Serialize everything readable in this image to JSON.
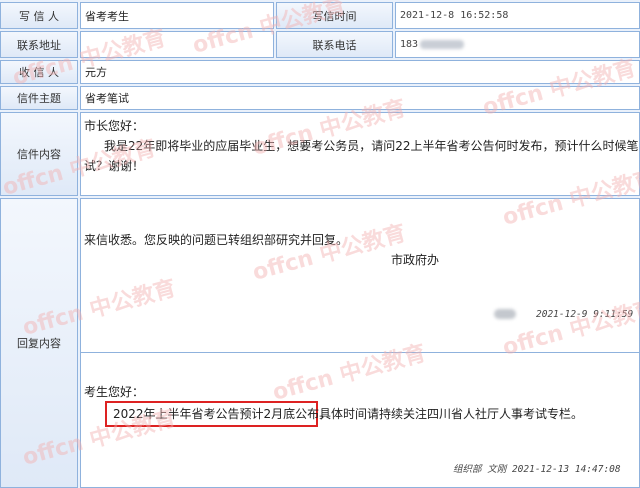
{
  "letter": {
    "writer_label": "写 信 人",
    "writer_value": "省考考生",
    "write_time_label": "写信时间",
    "write_time_value": "2021-12-8 16:52:58",
    "address_label": "联系地址",
    "phone_label": "联系电话",
    "phone_value": "183",
    "recipient_label": "收 信 人",
    "recipient_value": "元方",
    "subject_label": "信件主题",
    "subject_value": "省考笔试",
    "content_label": "信件内容",
    "content_greeting": "市长您好：",
    "content_line1": "我是22年即将毕业的应届毕业生，想要考公务员，请问22上半年省考公告何时发布，预计什么时候笔",
    "content_line2": "试？谢谢！"
  },
  "reply": {
    "label": "回复内容",
    "first": {
      "text": "来信收悉。您反映的问题已转组织部研究并回复。",
      "signature": "市政府办",
      "timestamp": "2021-12-9 9:11:59"
    },
    "second": {
      "greeting": "考生您好：",
      "highlight": "2022年上半年省考公告预计2月底公布，",
      "rest": "具体时间请持续关注四川省人社厅人事考试专栏。",
      "footer": "组织部 文刚     2021-12-13 14:47:08"
    }
  },
  "watermark": "offcn 中公教育",
  "colors": {
    "border": "#8fb2dd",
    "label_bg": "#e4ecf8",
    "highlight_box": "#d22222",
    "watermark": "#f3b0b0"
  }
}
